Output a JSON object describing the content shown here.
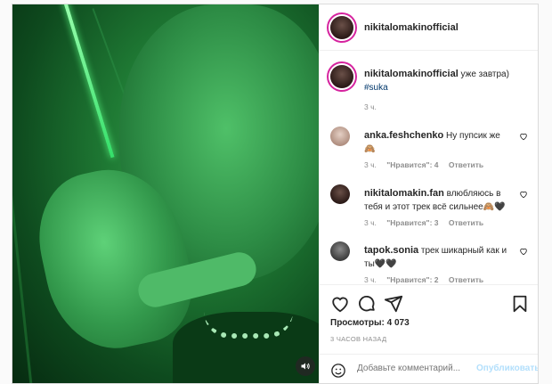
{
  "header": {
    "username": "nikitalomakinofficial"
  },
  "caption": {
    "username": "nikitalomakinofficial",
    "text": "уже завтра)",
    "hashtag": "#suka",
    "time": "3 ч."
  },
  "comments": [
    {
      "username": "anka.feshchenko",
      "text": "Ну пупсик же 🙈",
      "time": "3 ч.",
      "likes": "\"Нравится\": 4",
      "reply": "Ответить"
    },
    {
      "username": "nikitalomakin.fan",
      "text": "влюбляюсь в тебя и этот трек всё сильнее🙈🖤",
      "time": "3 ч.",
      "likes": "\"Нравится\": 3",
      "reply": "Ответить"
    },
    {
      "username": "tapok.sonia",
      "text": "трек шикарный как и ты🖤🖤",
      "time": "3 ч.",
      "likes": "\"Нравится\": 2",
      "reply": "Ответить"
    }
  ],
  "stats": {
    "views": "Просмотры: 4 073",
    "posted": "3 ЧАСОВ НАЗАД"
  },
  "add_comment": {
    "placeholder": "Добавьте комментарий...",
    "publish": "Опубликовать"
  },
  "icons": [
    "sound-icon",
    "like-icon",
    "comment-icon",
    "share-icon",
    "save-icon",
    "emoji-icon"
  ],
  "colors": {
    "accent_link": "#00376b",
    "publish_disabled": "#b2dffc",
    "meta": "#8e8e8e"
  }
}
